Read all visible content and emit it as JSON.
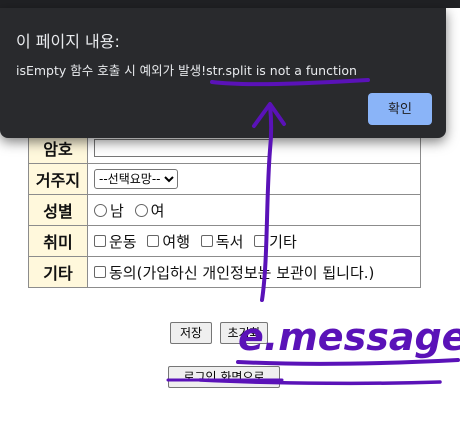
{
  "dialog": {
    "title": "이 페이지 내용:",
    "message": "isEmpty 함수 호출 시 예외가 발생!str.split is not a function",
    "ok_label": "확인"
  },
  "form": {
    "rows": [
      {
        "label": "암호"
      },
      {
        "label": "거주지",
        "select_value": "--선택요망--"
      },
      {
        "label": "성별",
        "options": [
          "남",
          "여"
        ]
      },
      {
        "label": "취미",
        "options": [
          "운동",
          "여행",
          "독서",
          "기타"
        ]
      },
      {
        "label": "기타",
        "agree_text": "동의(가입하신 개인정보는 보관이 됩니다.)"
      }
    ]
  },
  "buttons": {
    "save": "저장",
    "reset": "초기화",
    "login": "로그인 화면으로"
  },
  "annotation": {
    "text": "e.message",
    "color": "#5a12b8"
  }
}
